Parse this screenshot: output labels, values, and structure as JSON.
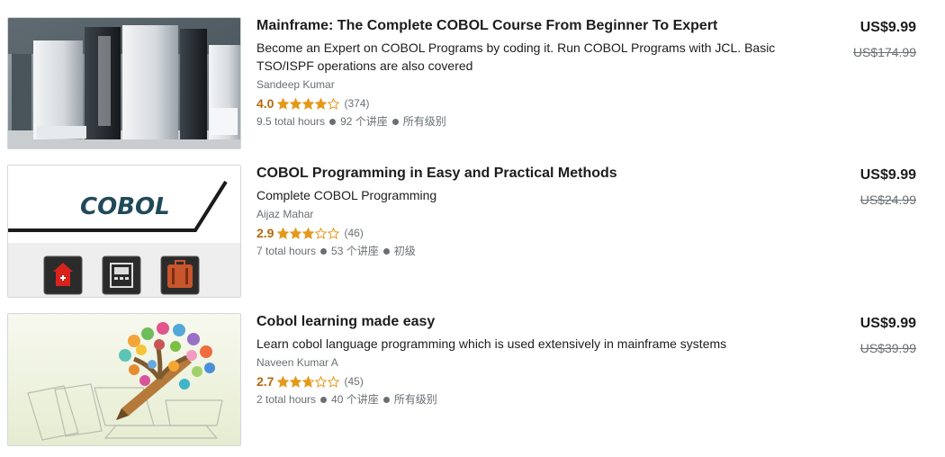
{
  "courses": [
    {
      "title": "Mainframe: The Complete COBOL Course From Beginner To Expert",
      "description": "Become an Expert on COBOL Programs by coding it. Run COBOL Programs with JCL. Basic TSO/ISPF operations are also covered",
      "author": "Sandeep Kumar",
      "rating": "4.0",
      "stars": 4.0,
      "rating_count": "(374)",
      "hours": "9.5 total hours",
      "lectures": "92 个讲座",
      "level": "所有级别",
      "price": "US$9.99",
      "original_price": "US$174.99"
    },
    {
      "title": "COBOL Programming in Easy and Practical Methods",
      "description": "Complete COBOL Programming",
      "author": "Aijaz Mahar",
      "rating": "2.9",
      "stars": 2.9,
      "rating_count": "(46)",
      "hours": "7 total hours",
      "lectures": "53 个讲座",
      "level": "初级",
      "thumb_text": "COBOL",
      "price": "US$9.99",
      "original_price": "US$24.99"
    },
    {
      "title": "Cobol learning made easy",
      "description": "Learn cobol language programming which is used extensively in mainframe systems",
      "author": "Naveen Kumar A",
      "rating": "2.7",
      "stars": 2.7,
      "rating_count": "(45)",
      "hours": "2 total hours",
      "lectures": "40 个讲座",
      "level": "所有级别",
      "price": "US$9.99",
      "original_price": "US$39.99"
    }
  ],
  "colors": {
    "rating": "#b4690e",
    "star": "#e59819",
    "muted": "#6a6f73",
    "text": "#1c1d1f"
  }
}
